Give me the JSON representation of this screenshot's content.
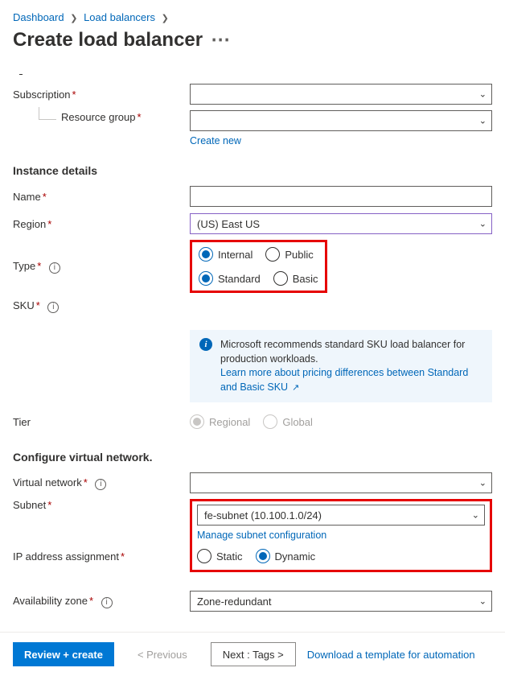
{
  "breadcrumb": {
    "items": [
      "Dashboard",
      "Load balancers"
    ]
  },
  "title": "Create load balancer",
  "labels": {
    "subscription": "Subscription",
    "resource_group": "Resource group",
    "create_new": "Create new",
    "instance_details": "Instance details",
    "name": "Name",
    "region": "Region",
    "type": "Type",
    "sku": "SKU",
    "tier": "Tier",
    "configure_vnet": "Configure virtual network.",
    "vnet": "Virtual network",
    "subnet": "Subnet",
    "manage_subnet": "Manage subnet configuration",
    "ip_assign": "IP address assignment",
    "avail_zone": "Availability zone"
  },
  "values": {
    "subscription": "",
    "resource_group": "",
    "name": "",
    "region": "(US) East US",
    "vnet": "",
    "subnet": "fe-subnet (10.100.1.0/24)",
    "avail_zone": "Zone-redundant"
  },
  "radios": {
    "type": {
      "internal": "Internal",
      "public": "Public"
    },
    "sku": {
      "standard": "Standard",
      "basic": "Basic"
    },
    "tier": {
      "regional": "Regional",
      "global": "Global"
    },
    "ip": {
      "static": "Static",
      "dynamic": "Dynamic"
    }
  },
  "info": {
    "text": "Microsoft recommends standard SKU load balancer for production workloads.",
    "link": "Learn more about pricing differences between Standard and Basic SKU"
  },
  "footer": {
    "review": "Review + create",
    "previous": "< Previous",
    "next": "Next : Tags >",
    "download": "Download a template for automation"
  }
}
